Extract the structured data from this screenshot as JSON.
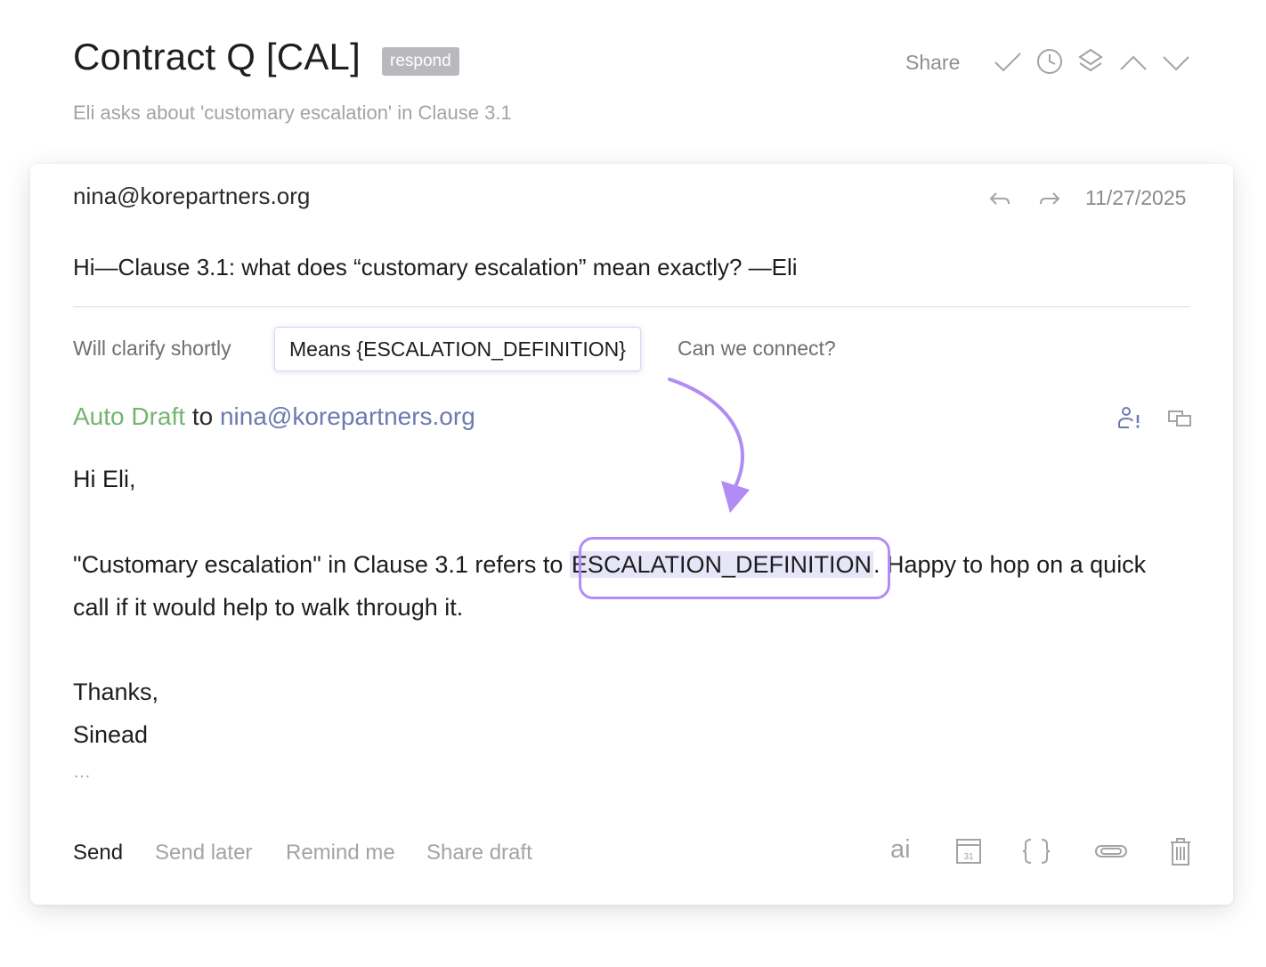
{
  "header": {
    "title": "Contract Q [CAL]",
    "badge": "respond",
    "subtitle": "Eli asks about 'customary escalation' in Clause 3.1",
    "share_label": "Share",
    "icons": [
      "check-icon",
      "clock-icon",
      "layers-icon",
      "chevron-up-icon",
      "chevron-down-icon"
    ]
  },
  "message": {
    "from": "nina@korepartners.org",
    "date": "11/27/2025",
    "body": "Hi—Clause 3.1: what does “customary escalation” mean exactly? —Eli",
    "icons": [
      "reply-icon",
      "forward-icon"
    ]
  },
  "suggestions": [
    {
      "label": "Will clarify shortly",
      "selected": false
    },
    {
      "label": "Means {ESCALATION_DEFINITION}",
      "selected": true
    },
    {
      "label": "Can we connect?",
      "selected": false
    }
  ],
  "draft": {
    "auto_label": "Auto Draft",
    "to_word": "to",
    "to_email": "nina@korepartners.org",
    "greeting": "Hi Eli,",
    "line_before": "\"Customary escalation\" in Clause 3.1 refers to ",
    "placeholder": "ESCALATION_DEFINITION",
    "line_after": ". Happy to hop on a quick",
    "line_cont": "call if it would help to walk through it.",
    "signoff": "Thanks,",
    "signature": "Sinead",
    "ellipsis": "…"
  },
  "actions": {
    "send": "Send",
    "send_later": "Send later",
    "remind_me": "Remind me",
    "share_draft": "Share draft"
  },
  "tools": {
    "ai_label": "ai",
    "calendar_day": "31",
    "icons": [
      "ai-icon",
      "calendar-icon",
      "braces-icon",
      "paperclip-icon",
      "trash-icon"
    ]
  },
  "colors": {
    "accent_purple": "#b18cf4",
    "auto_draft_green": "#74b472",
    "email_blue": "#6c7ab0",
    "badge_gray": "#b9b8bc",
    "placeholder_bg": "#e6e6f8"
  }
}
